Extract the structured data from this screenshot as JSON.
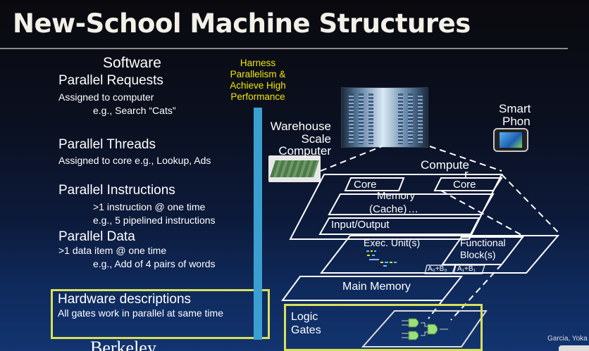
{
  "title": "New-School Machine Structures",
  "software": {
    "heading": "Software",
    "parallel_requests": {
      "heading": "Parallel Requests",
      "line1": "Assigned to computer",
      "line2": "e.g., Search “Cats”"
    },
    "parallel_threads": {
      "heading": "Parallel Threads",
      "line1": "Assigned to core e.g., Lookup, Ads"
    },
    "parallel_instructions": {
      "heading": "Parallel Instructions",
      "line1": ">1 instruction @ one time",
      "line2": "e.g., 5 pipelined instructions"
    },
    "parallel_data": {
      "heading": "Parallel Data",
      "line1": ">1 data item @ one time",
      "line2": "e.g., Add of 4 pairs of words"
    },
    "hardware_descriptions": {
      "heading": "Hardware descriptions",
      "line1": "All gates work in parallel at same time"
    }
  },
  "harness": {
    "line1": "Harness",
    "line2": "Parallelism &",
    "line3": "Achieve High",
    "line4": "Performance"
  },
  "hardware": {
    "warehouse": {
      "line1": "Warehouse",
      "line2": "Scale",
      "line3": "Computer"
    },
    "smart_phone": {
      "line1": "Smart",
      "line2": "Phon"
    },
    "computer": {
      "label": "Compute",
      "label_tail": "r",
      "core_left": "Core",
      "core_right": "Core",
      "ellipsis": "…",
      "memory": "Memory",
      "cache": "(Cache)",
      "io": "Input/Output"
    },
    "core_detail": {
      "exec_unit": "Exec. Unit(s)",
      "functional_block_line1": "Functional",
      "functional_block_line2": "Block(s)",
      "a0b0": "A₀+B₀",
      "a1b1": "A₁+B₁"
    },
    "main_memory": "Main Memory",
    "logic_gates": {
      "line1": "Logic",
      "line2": "Gates"
    }
  },
  "credit": "Garcia, Yoka",
  "berkeley": "Berkeley",
  "colors": {
    "accent_yellow": "#f2e600",
    "box_outline": "#d8e05a",
    "bar_blue": "#3b9fd1",
    "title_color": "#f3f0e8"
  }
}
